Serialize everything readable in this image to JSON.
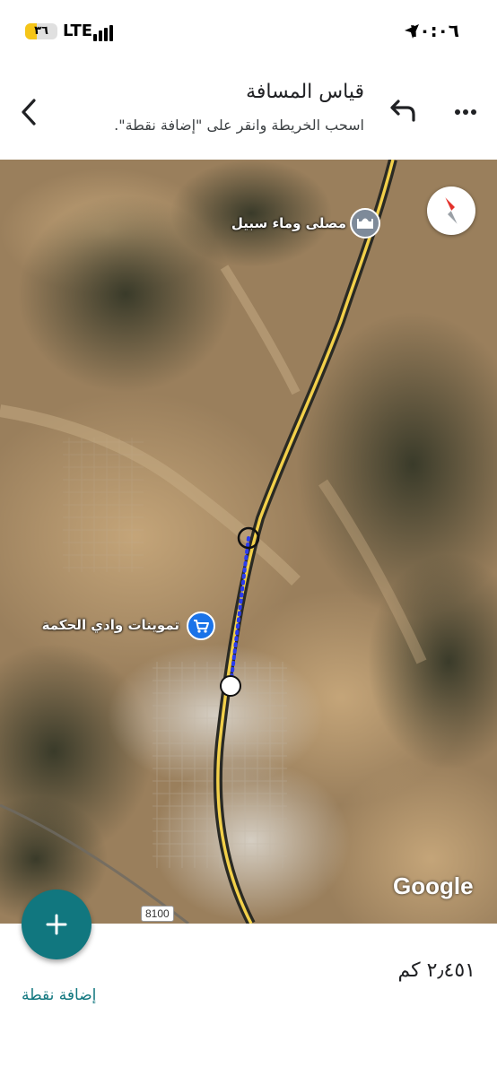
{
  "status_bar": {
    "time": "١٠:٠٦",
    "battery_level": "٣٦",
    "battery_fraction": 0.36,
    "network": "LTE"
  },
  "header": {
    "title": "قياس المسافة",
    "subtitle": "اسحب الخريطة وانقر على \"إضافة نقطة\"."
  },
  "map": {
    "poi_mosque_label": "مصلى وماء سبيل",
    "poi_shop_label": "تموينات وادي الحكمة",
    "road_number": "8100",
    "logo_text": "Google",
    "highway_color": "#f2d04a",
    "measure_line_color": "#2a3cf0",
    "poi_mosque_color": "#7e8a99",
    "poi_shop_color": "#1a73e8",
    "icons": [
      "compass-icon",
      "mosque-icon",
      "shopping-cart-icon"
    ]
  },
  "bottom": {
    "distance": "٢٫٤٥١ كم",
    "add_point_label": "إضافة نقطة",
    "fab_icon": "plus-icon",
    "accent_color": "#11777f"
  }
}
